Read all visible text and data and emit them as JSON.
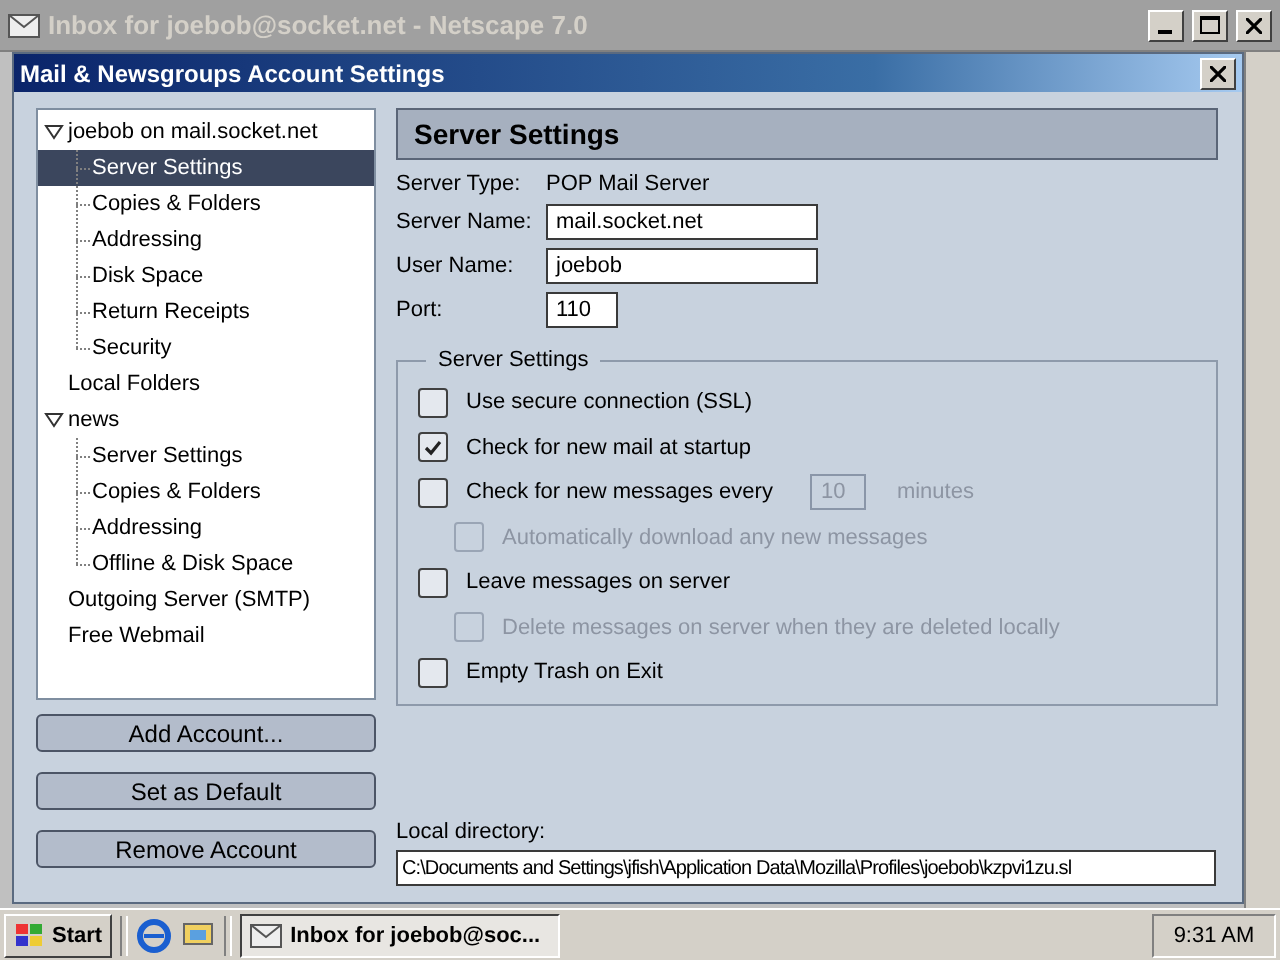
{
  "window": {
    "title": "Inbox for joebob@socket.net - Netscape 7.0"
  },
  "dialog": {
    "title": "Mail & Newsgroups Account Settings"
  },
  "tree": [
    {
      "label": "joebob on mail.socket.net",
      "expanded": true,
      "selected": false,
      "children": [
        {
          "label": "Server Settings",
          "selected": true
        },
        {
          "label": "Copies & Folders",
          "selected": false
        },
        {
          "label": "Addressing",
          "selected": false
        },
        {
          "label": "Disk Space",
          "selected": false
        },
        {
          "label": "Return Receipts",
          "selected": false
        },
        {
          "label": "Security",
          "selected": false
        }
      ]
    },
    {
      "label": "Local Folders",
      "selected": false
    },
    {
      "label": "news",
      "expanded": true,
      "selected": false,
      "children": [
        {
          "label": "Server Settings",
          "selected": false
        },
        {
          "label": "Copies & Folders",
          "selected": false
        },
        {
          "label": "Addressing",
          "selected": false
        },
        {
          "label": "Offline & Disk Space",
          "selected": false
        }
      ]
    },
    {
      "label": "Outgoing Server (SMTP)",
      "selected": false
    },
    {
      "label": "Free Webmail",
      "selected": false
    }
  ],
  "buttons": [
    "Add Account...",
    "Set as Default",
    "Remove Account"
  ],
  "panel": {
    "title": "Server Settings",
    "info": [
      {
        "kind": "text",
        "label": "Server Type:",
        "value": "POP Mail Server"
      },
      {
        "kind": "field",
        "label": "Server Name:",
        "value": "mail.socket.net"
      },
      {
        "kind": "field",
        "label": "User Name:",
        "value": "joebob"
      },
      {
        "kind": "short",
        "label": "Port:",
        "value": "110"
      }
    ],
    "group": {
      "title": "Server Settings",
      "options": [
        {
          "kind": "check",
          "label": "Use secure connection (SSL)",
          "checked": false,
          "disabled": false
        },
        {
          "kind": "check",
          "label": "Check for new mail at startup",
          "checked": true,
          "disabled": false
        },
        {
          "kind": "interval",
          "label": "Check for new messages every",
          "checked": false,
          "disabled": false,
          "value": "10",
          "unit": "minutes",
          "children": [
            {
              "kind": "check",
              "label": "Automatically download any new messages",
              "checked": false,
              "disabled": true
            }
          ]
        },
        {
          "kind": "check",
          "label": "Leave messages on server",
          "checked": false,
          "disabled": false,
          "children": [
            {
              "kind": "check",
              "label": "Delete messages on server when they are deleted locally",
              "checked": false,
              "disabled": true
            }
          ]
        },
        {
          "kind": "check",
          "label": "Empty Trash on Exit",
          "checked": false,
          "disabled": false
        }
      ]
    },
    "local_directory": {
      "label": "Local directory:",
      "value": "C:\\Documents and Settings\\jfish\\Application Data\\Mozilla\\Profiles\\joebob\\kzpvi1zu.sl"
    }
  },
  "taskbar": {
    "start": "Start",
    "tasks": [
      {
        "label": "Inbox for joebob@soc...",
        "selected": true
      }
    ],
    "clock": "9:31 AM"
  }
}
